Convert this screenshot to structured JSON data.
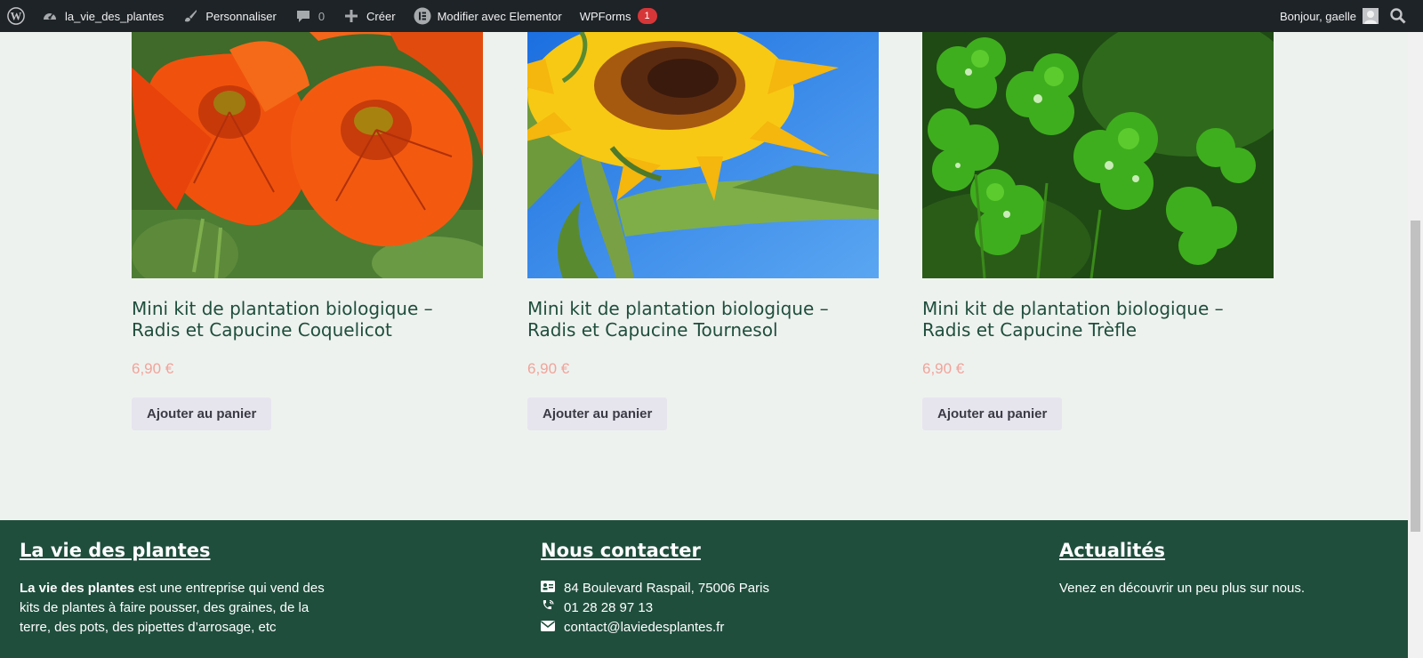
{
  "admin_bar": {
    "site_name": "la_vie_des_plantes",
    "customize": "Personnaliser",
    "comments_count": "0",
    "new": "Créer",
    "elementor": "Modifier avec Elementor",
    "wpforms": "WPForms",
    "wpforms_badge": "1",
    "greeting": "Bonjour, gaelle"
  },
  "products": [
    {
      "title_line1": "Mini kit de plantation biologique –",
      "title_line2": "Radis et Capucine Coquelicot",
      "price": "6,90 €",
      "button": "Ajouter au panier"
    },
    {
      "title_line1": "Mini kit de plantation biologique –",
      "title_line2": "Radis et Capucine Tournesol",
      "price": "6,90 €",
      "button": "Ajouter au panier"
    },
    {
      "title_line1": "Mini kit de plantation biologique –",
      "title_line2": "Radis et Capucine Trèfle",
      "price": "6,90 €",
      "button": "Ajouter au panier"
    }
  ],
  "footer": {
    "about": {
      "heading": "La vie des plantes",
      "brand": "La vie des plantes",
      "text_line1": " est une entreprise qui vend des",
      "text_line2": "kits de plantes à faire pousser, des graines, de la",
      "text_line3": "terre, des pots, des pipettes d’arrosage, etc"
    },
    "contact": {
      "heading": "Nous contacter",
      "address": "84 Boulevard Raspail, 75006 Paris",
      "phone": "01 28 28 97 13",
      "email": "contact@laviedesplantes.fr"
    },
    "news": {
      "heading": "Actualités",
      "text": "Venez en découvrir un peu plus sur nous."
    }
  },
  "colors": {
    "admin_bar": "#1d2327",
    "footer_bg": "#1f4e3d",
    "title": "#1f4e3d",
    "price": "#f0a49a",
    "page_bg": "#eef2ef"
  }
}
